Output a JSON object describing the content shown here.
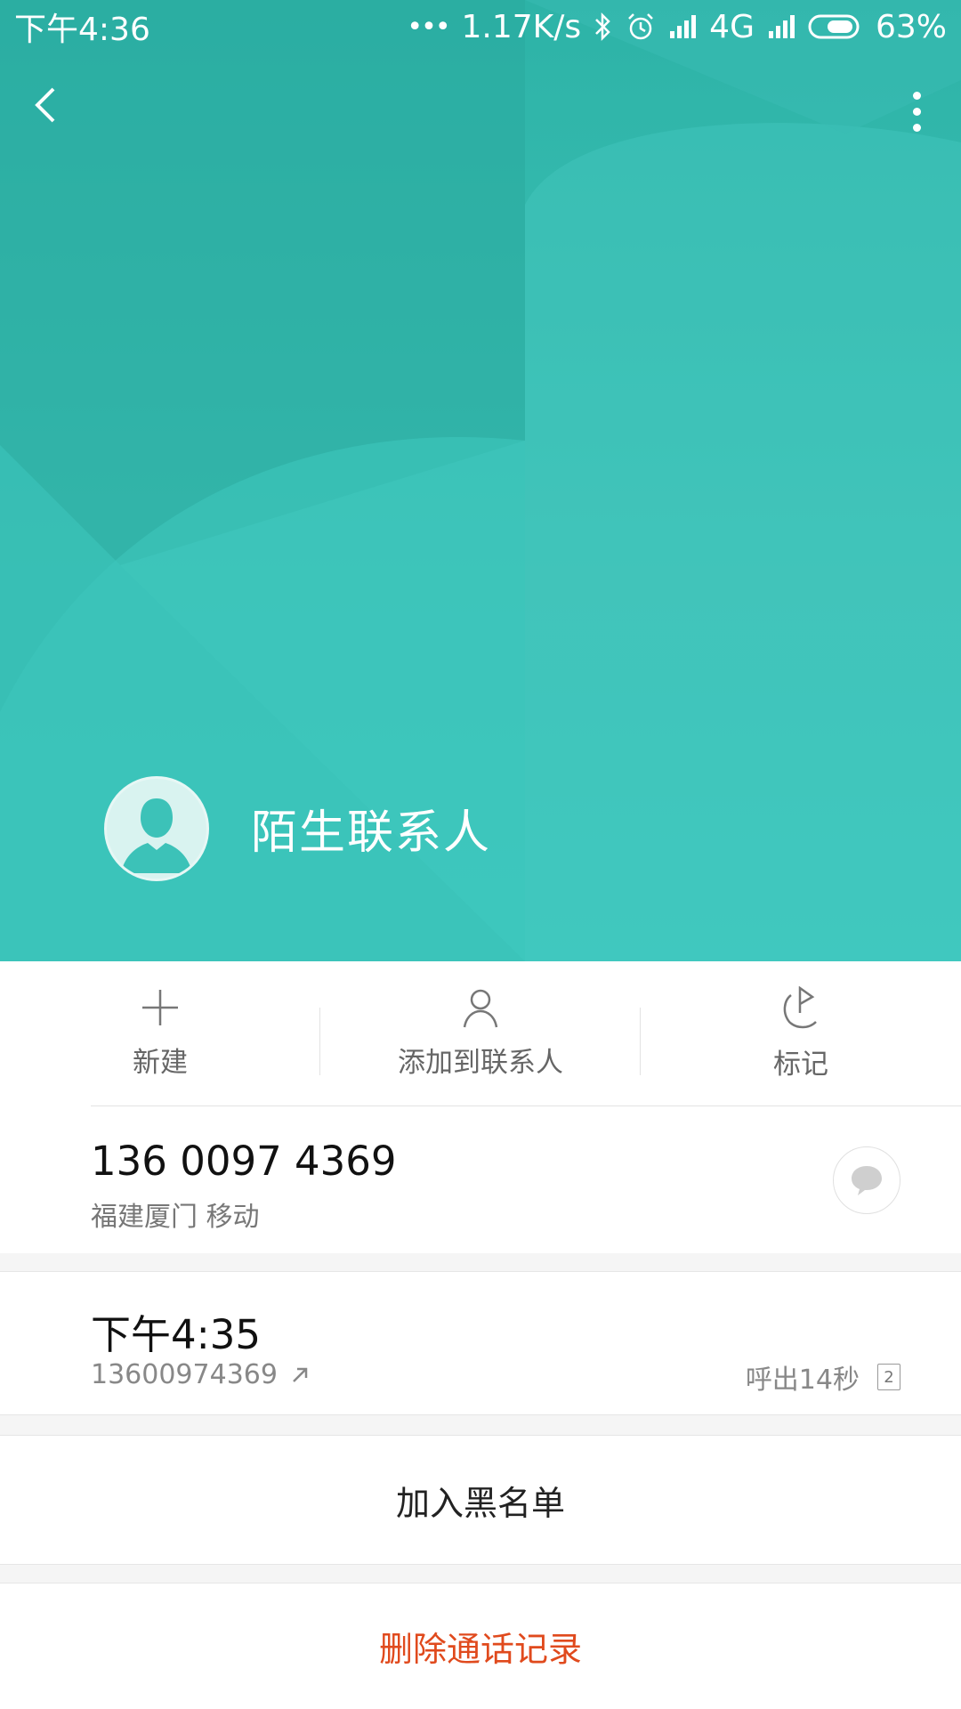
{
  "status_bar": {
    "time": "下午4:36",
    "net_speed": "1.17K/s",
    "network": "4G",
    "battery": "63%"
  },
  "header": {
    "contact_name": "陌生联系人",
    "back_icon": "chevron-left-icon",
    "more_icon": "more-vertical-icon"
  },
  "actions": [
    {
      "label": "新建",
      "icon": "plus-icon"
    },
    {
      "label": "添加到联系人",
      "icon": "person-icon"
    },
    {
      "label": "标记",
      "icon": "flag-icon"
    }
  ],
  "number_info": {
    "number": "136 0097 4369",
    "location": "福建厦门 移动"
  },
  "call_record": {
    "time": "下午4:35",
    "number": "13600974369",
    "direction_label": "呼出14秒",
    "sim": "2"
  },
  "buttons": {
    "blacklist": "加入黑名单",
    "delete": "删除通话记录"
  },
  "colors": {
    "header": "#3cc2b8",
    "danger": "#e04a1d"
  }
}
